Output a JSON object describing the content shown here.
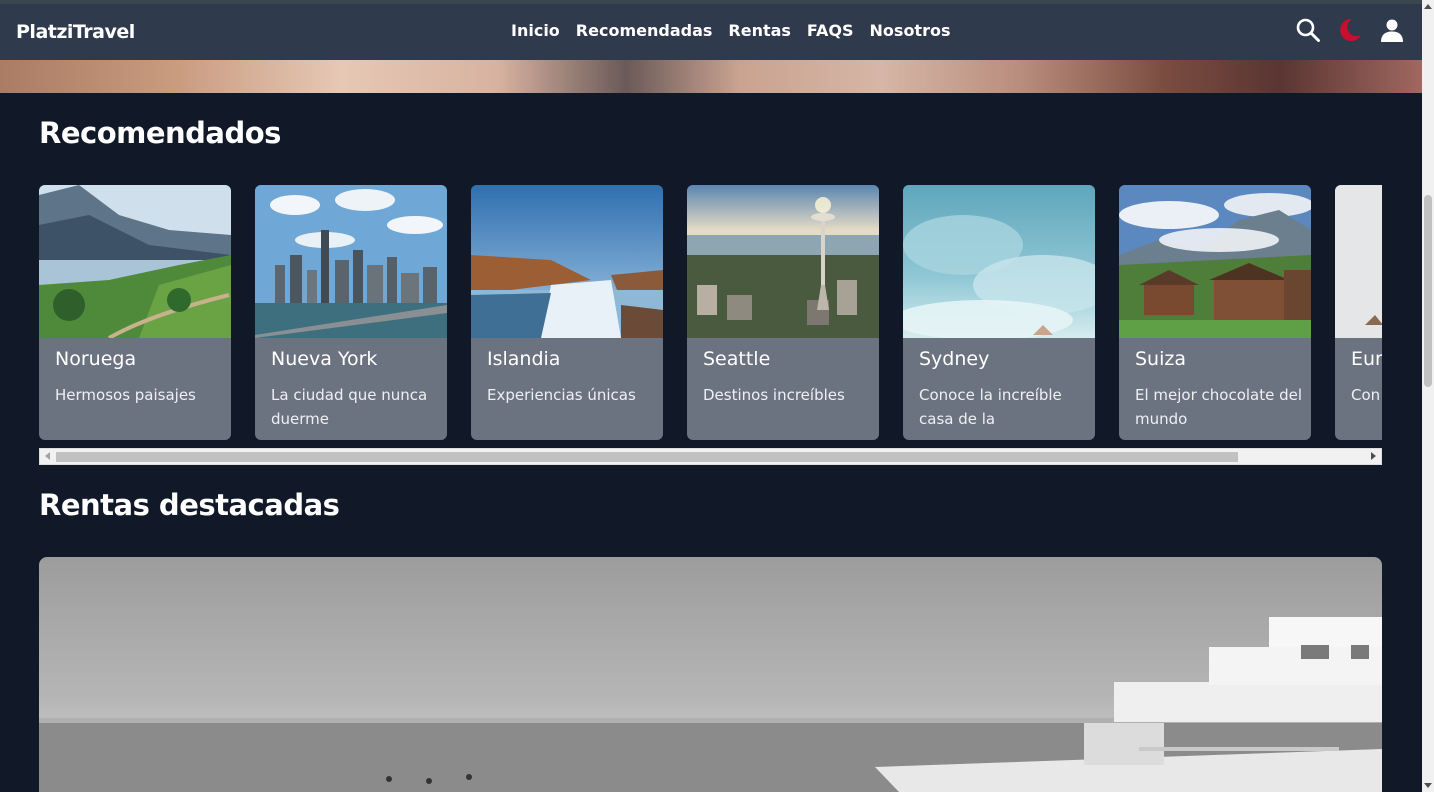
{
  "header": {
    "brand": "PlatziTravel",
    "nav": [
      "Inicio",
      "Recomendadas",
      "Rentas",
      "FAQS",
      "Nosotros"
    ],
    "icons": [
      "search-icon",
      "moon-icon",
      "user-icon"
    ],
    "accent_color": "#c8102e"
  },
  "recommended": {
    "title": "Recomendados",
    "cards": [
      {
        "title": "Noruega",
        "desc": "Hermosos paisajes"
      },
      {
        "title": "Nueva York",
        "desc": "La ciudad que nunca duerme"
      },
      {
        "title": "Islandia",
        "desc": "Experiencias únicas"
      },
      {
        "title": "Seattle",
        "desc": "Destinos increíbles"
      },
      {
        "title": "Sydney",
        "desc": "Conoce la increíble casa de la"
      },
      {
        "title": "Suiza",
        "desc": "El mejor chocolate del mundo"
      },
      {
        "title": "Eur",
        "desc": "Con de c"
      }
    ]
  },
  "rentals": {
    "title": "Rentas destacadas"
  }
}
